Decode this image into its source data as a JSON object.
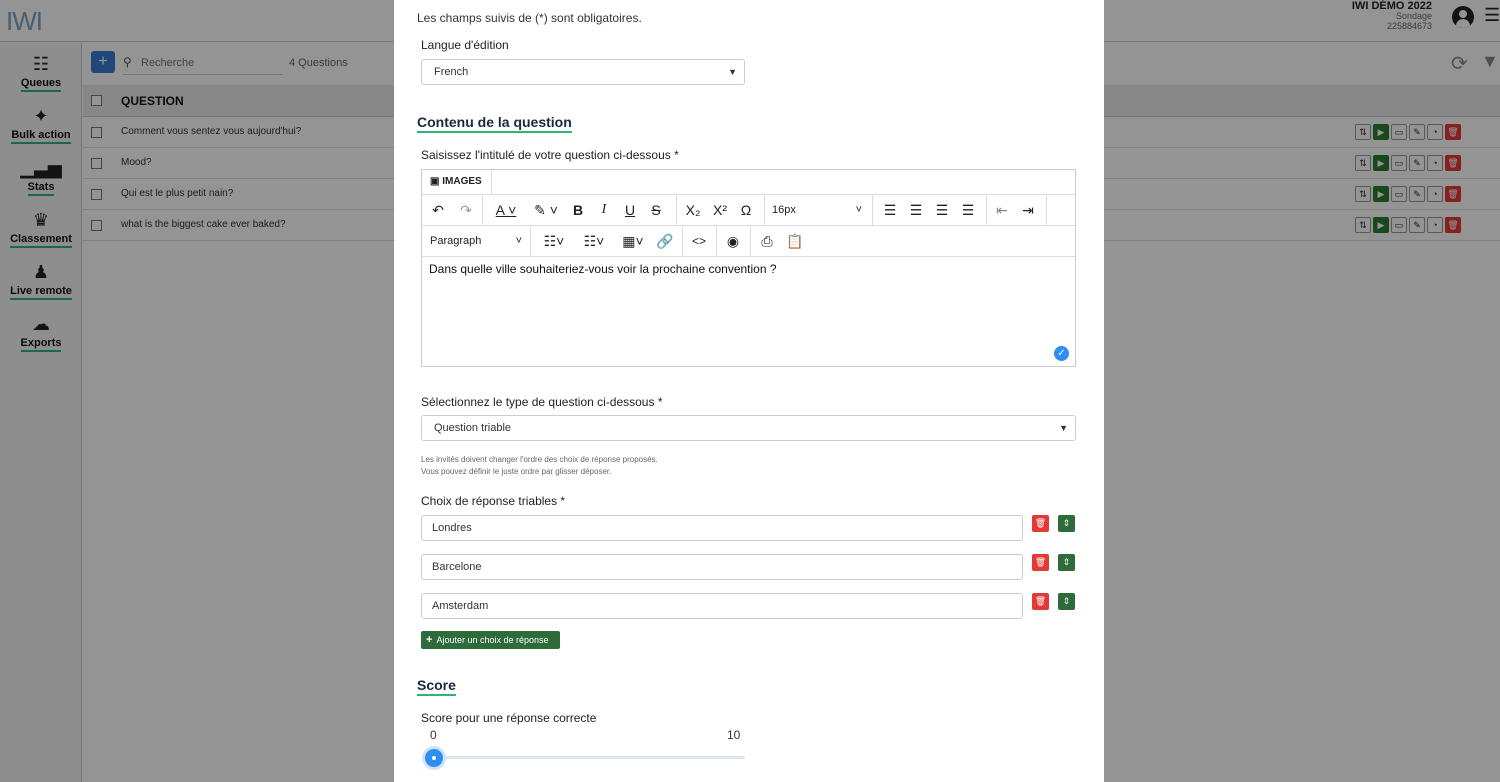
{
  "app": {
    "logo_text": "IWI",
    "event_title": "IWI DÉMO 2022",
    "event_subtitle": "Sondage",
    "event_id": "225884673"
  },
  "sidebar": {
    "items": [
      {
        "label": "Queues",
        "icon": "list-icon"
      },
      {
        "label": "Bulk action",
        "icon": "magic-wand-icon"
      },
      {
        "label": "Stats",
        "icon": "bar-chart-icon"
      },
      {
        "label": "Classement",
        "icon": "trophy-icon"
      },
      {
        "label": "Live remote",
        "icon": "joystick-icon"
      },
      {
        "label": "Exports",
        "icon": "cloud-download-icon"
      }
    ]
  },
  "toolbar": {
    "search_placeholder": "Recherche",
    "question_count": "4 Questions"
  },
  "table": {
    "header": "QUESTION",
    "rows": [
      "Comment vous sentez vous aujourd'hui?",
      "Mood?",
      "Qui est le plus petit nain?",
      "what is the biggest cake ever baked?"
    ]
  },
  "modal": {
    "required_note": "Les champs suivis de (*) sont obligatoires.",
    "language_label": "Langue d'édition",
    "language_value": "French",
    "content_section": "Contenu de la question",
    "question_label": "Saisissez l'intitulé de votre question ci-dessous *",
    "editor": {
      "images_tab": "IMAGES",
      "font_size": "16px",
      "block_format": "Paragraph",
      "content": "Dans quelle ville souhaiteriez-vous voir la prochaine convention ?"
    },
    "type_label": "Sélectionnez le type de question ci-dessous *",
    "type_value": "Question triable",
    "type_help_1": "Les invités doivent changer l'ordre des choix de réponse proposés.",
    "type_help_2": "Vous pouvez définir le juste ordre par glisser déposer.",
    "choices_label": "Choix de réponse triables *",
    "choices": [
      "Londres",
      "Barcelone",
      "Amsterdam"
    ],
    "add_choice_label": "Ajouter un choix de réponse",
    "score_section": "Score",
    "score_label": "Score pour une réponse correcte",
    "score_min": "0",
    "score_max": "10",
    "score_value": 0
  },
  "colors": {
    "accent_green": "#2bb673",
    "primary_blue": "#2f8ff0",
    "danger_red": "#e53935",
    "dark_green": "#2e6b3a"
  }
}
